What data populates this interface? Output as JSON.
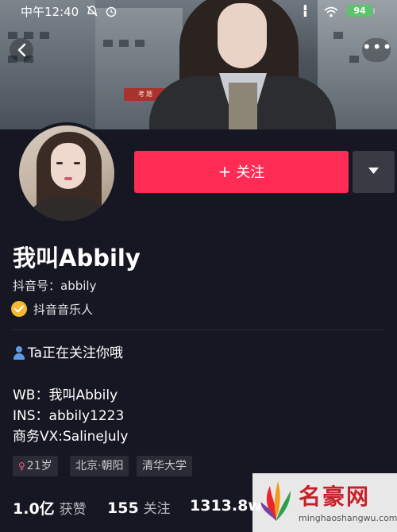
{
  "status_bar": {
    "time": "中午12:40",
    "battery": "94"
  },
  "header": {
    "sign_text": "考题"
  },
  "actions": {
    "follow_label": "关注",
    "follow_plus": "+",
    "more_label": "•••"
  },
  "profile": {
    "nickname": "我叫Abbily",
    "douyin_id": "抖音号：abbily",
    "badge": "抖音音乐人"
  },
  "bio": {
    "following_you": "Ta正在关注你哦",
    "wb": "WB：我叫Abbily",
    "ins": "INS：abbily1223",
    "vx": "商务VX:SalineJuly"
  },
  "tags": {
    "age": "21岁",
    "location": "北京·朝阳",
    "school": "清华大学"
  },
  "stats": {
    "likes_num": "1.0亿",
    "likes_label": "获赞",
    "following_num": "155",
    "following_label": "关注",
    "followers_num": "1313.8w"
  },
  "watermark": {
    "name": "名豪网",
    "url": "minghaoshangwu.com"
  },
  "colors": {
    "background": "#161722",
    "follow_button": "#fe2c55",
    "dropdown_button": "#393b44",
    "badge": "#f5b82e",
    "battery": "#5cc46a"
  },
  "icons": [
    "back-arrow-icon",
    "more-dots-icon",
    "chevron-down-icon",
    "verified-check-icon",
    "person-icon",
    "female-icon",
    "wifi-icon",
    "alarm-icon",
    "mute-icon"
  ]
}
